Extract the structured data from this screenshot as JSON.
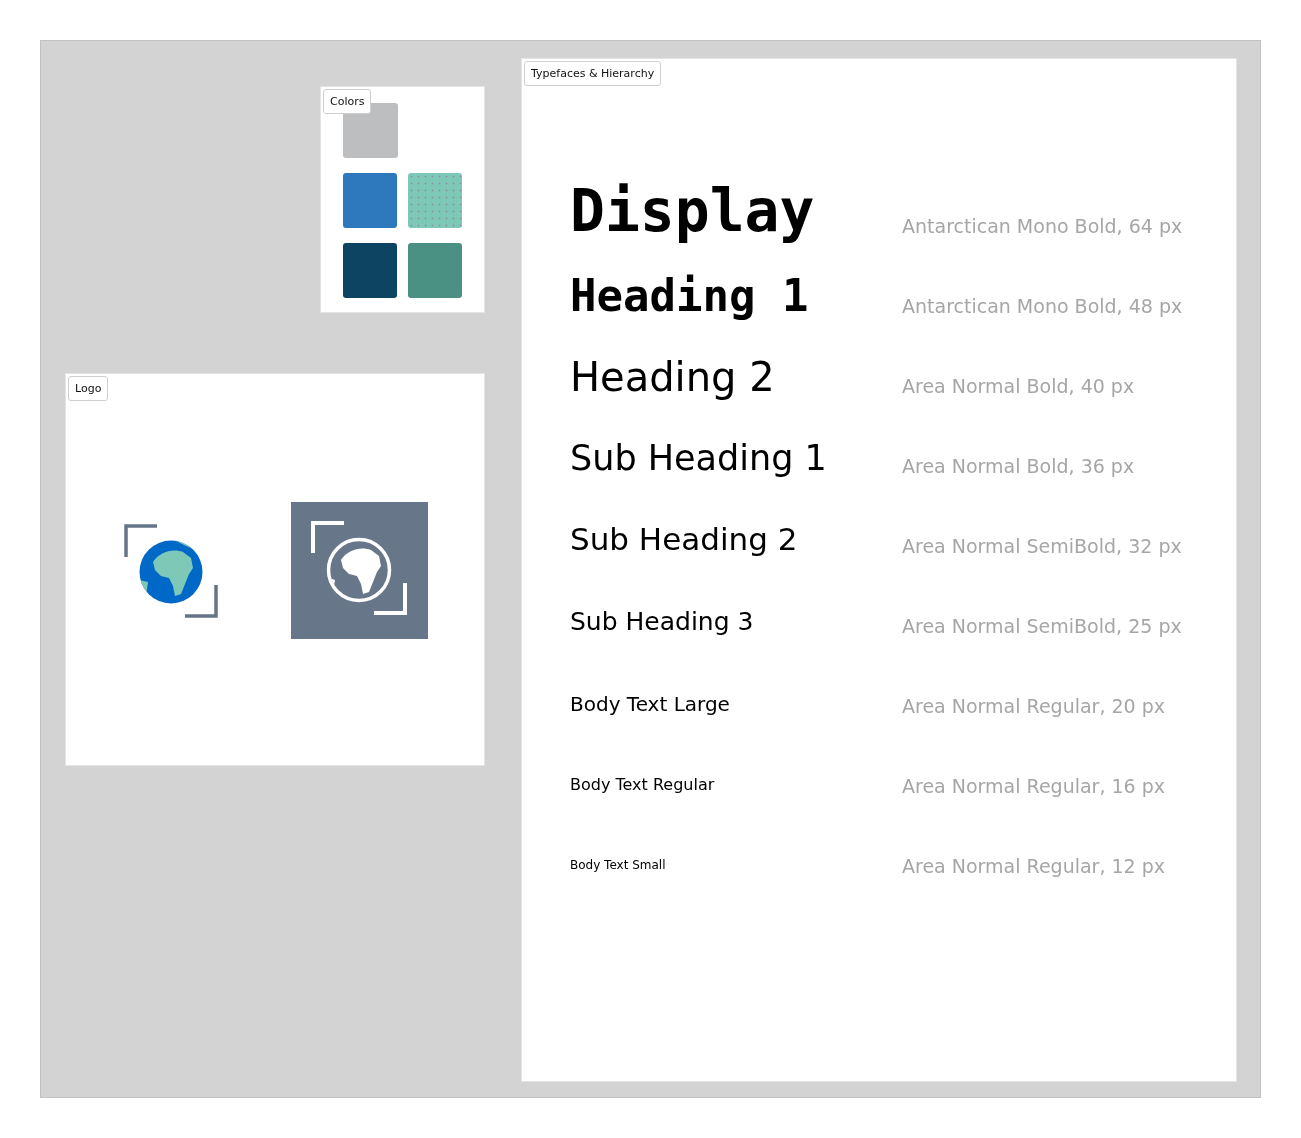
{
  "colors_panel": {
    "tag": "Colors",
    "swatch_rows": [
      [
        {
          "color": "#bdbec0",
          "kind": "solid"
        }
      ],
      [
        {
          "color": "#2e79bd",
          "kind": "solid"
        },
        {
          "color": "#7ec8b8",
          "kind": "dotted"
        }
      ],
      [
        {
          "color": "#0d4462",
          "kind": "solid"
        },
        {
          "color": "#4a9183",
          "kind": "solid"
        }
      ]
    ]
  },
  "logo_panel": {
    "tag": "Logo",
    "logos": [
      {
        "kind": "color"
      },
      {
        "kind": "inverse"
      }
    ]
  },
  "type_panel": {
    "tag": "Typefaces & Hierarchy",
    "styles": [
      {
        "kind": "display",
        "label": "Display",
        "spec": "Antarctican Mono Bold, 64 px"
      },
      {
        "kind": "h1",
        "label": "Heading 1",
        "spec": "Antarctican Mono Bold, 48 px"
      },
      {
        "kind": "h2",
        "label": "Heading 2",
        "spec": "Area Normal Bold, 40 px"
      },
      {
        "kind": "sub1",
        "label": "Sub Heading 1",
        "spec": "Area Normal Bold, 36 px"
      },
      {
        "kind": "sub2",
        "label": "Sub Heading 2",
        "spec": "Area Normal SemiBold, 32 px"
      },
      {
        "kind": "sub3",
        "label": "Sub Heading 3",
        "spec": "Area Normal SemiBold, 25 px"
      },
      {
        "kind": "body-lg",
        "label": "Body Text Large",
        "spec": "Area Normal Regular, 20 px"
      },
      {
        "kind": "body",
        "label": "Body Text Regular",
        "spec": "Area Normal Regular, 16 px"
      },
      {
        "kind": "body-sm",
        "label": "Body Text Small",
        "spec": "Area Normal Regular, 12 px"
      }
    ]
  }
}
